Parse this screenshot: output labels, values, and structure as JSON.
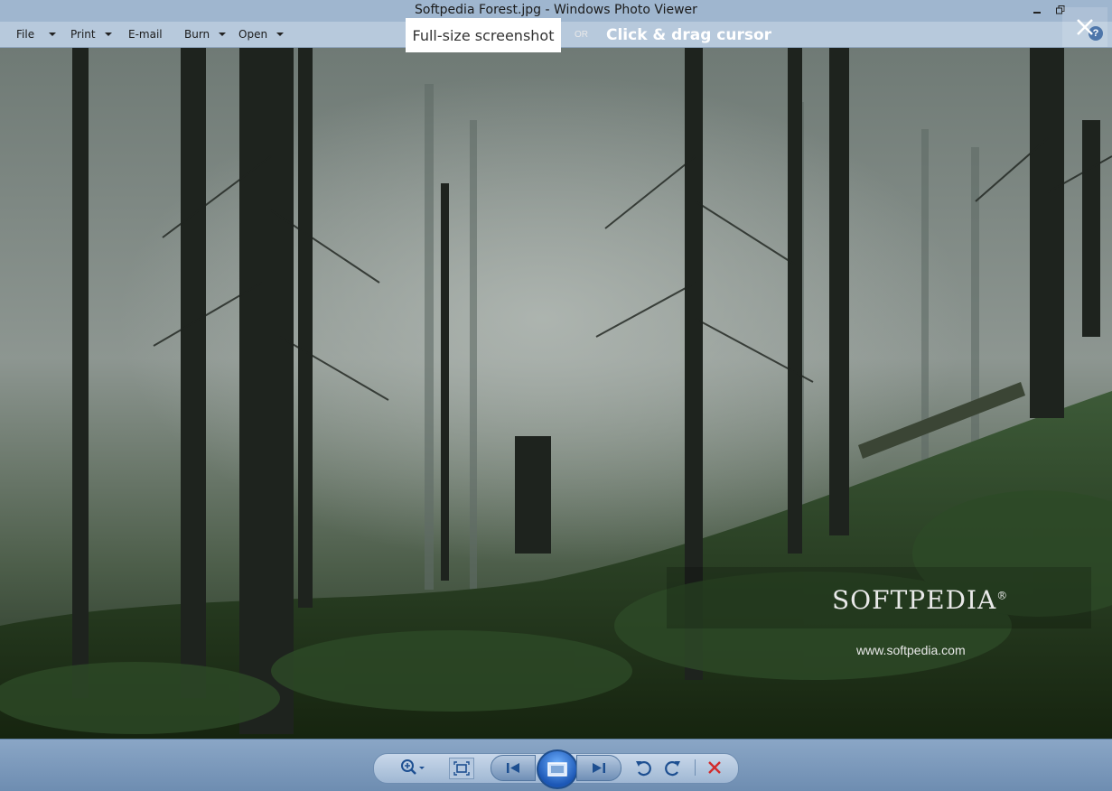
{
  "window": {
    "title": "Softpedia Forest.jpg - Windows Photo Viewer"
  },
  "menu": {
    "items": [
      {
        "label": "File",
        "dropdown": true
      },
      {
        "label": "Print",
        "dropdown": true
      },
      {
        "label": "E-mail",
        "dropdown": false
      },
      {
        "label": "Burn",
        "dropdown": true
      },
      {
        "label": "Open",
        "dropdown": true
      }
    ],
    "help_label": "?"
  },
  "overlay": {
    "fullsize_label": "Full-size screenshot",
    "or_label": "OR",
    "drag_label": "Click & drag cursor"
  },
  "watermark": {
    "brand": "SOFTPEDIA",
    "url": "www.softpedia.com"
  },
  "colors": {
    "titlebar": "#9fb6cf",
    "menubar": "#b7c9dc",
    "bottombar": "#7b98ba",
    "delete": "#d22b2b",
    "icon_blue": "#1d4f91"
  }
}
